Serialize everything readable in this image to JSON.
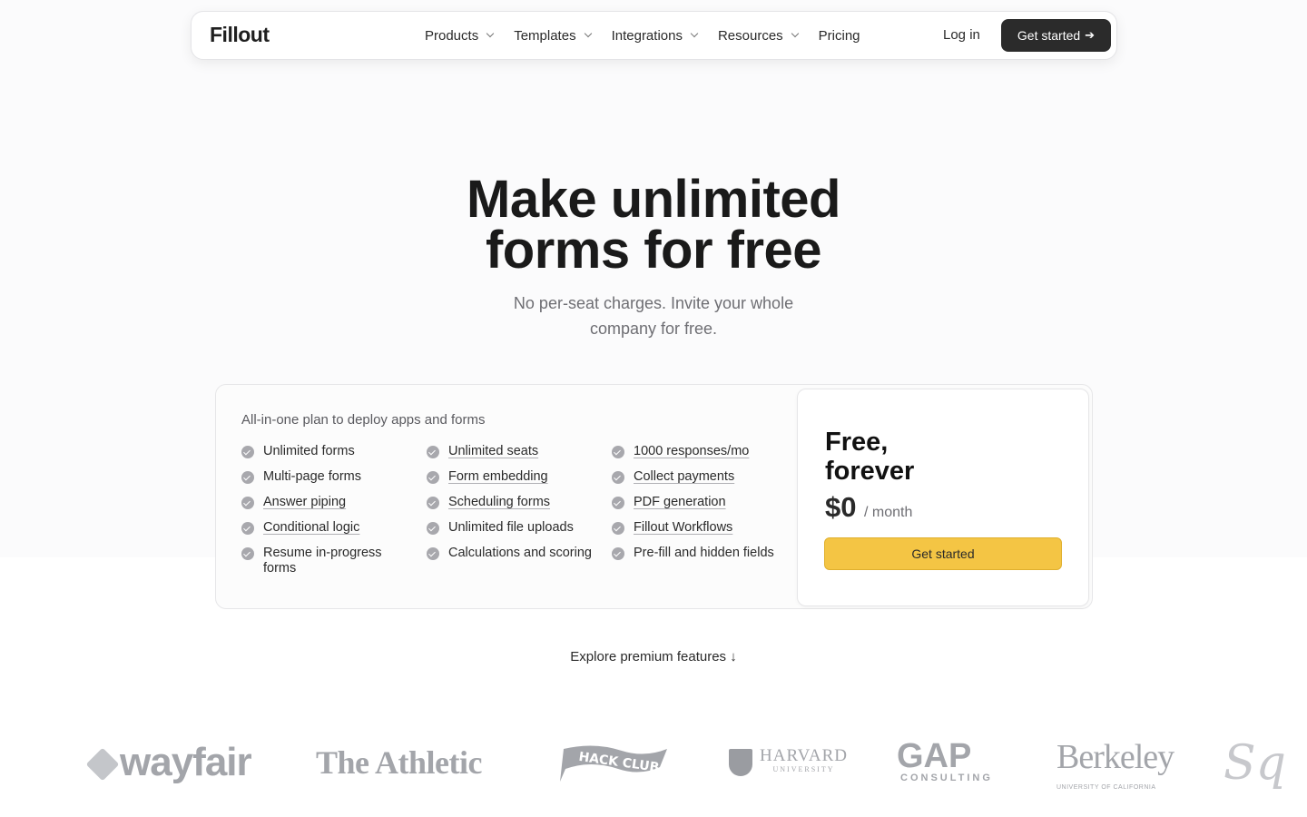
{
  "nav": {
    "logo": "Fillout",
    "items": [
      {
        "label": "Products",
        "has_dropdown": true
      },
      {
        "label": "Templates",
        "has_dropdown": true
      },
      {
        "label": "Integrations",
        "has_dropdown": true
      },
      {
        "label": "Resources",
        "has_dropdown": true
      },
      {
        "label": "Pricing",
        "has_dropdown": false
      }
    ],
    "login": "Log in",
    "cta": "Get started",
    "cta_arrow": "➔"
  },
  "hero": {
    "title_line1": "Make unlimited",
    "title_line2": "forms for free",
    "subtitle": "No per-seat charges. Invite your whole company for free."
  },
  "plan": {
    "heading": "All-in-one plan to deploy apps and forms",
    "features": [
      [
        {
          "label": "Unlimited forms",
          "underlined": false
        },
        {
          "label": "Multi-page forms",
          "underlined": false
        },
        {
          "label": "Answer piping",
          "underlined": true
        },
        {
          "label": "Conditional logic",
          "underlined": true
        },
        {
          "label": "Resume in-progress forms",
          "underlined": false
        }
      ],
      [
        {
          "label": "Unlimited seats",
          "underlined": true
        },
        {
          "label": "Form embedding",
          "underlined": true
        },
        {
          "label": "Scheduling forms",
          "underlined": true
        },
        {
          "label": "Unlimited file uploads",
          "underlined": false
        },
        {
          "label": "Calculations and scoring",
          "underlined": false
        }
      ],
      [
        {
          "label": "1000 responses/mo",
          "underlined": true
        },
        {
          "label": "Collect payments",
          "underlined": true
        },
        {
          "label": "PDF generation",
          "underlined": true
        },
        {
          "label": "Fillout Workflows",
          "underlined": true
        },
        {
          "label": "Pre-fill and hidden fields",
          "underlined": false
        }
      ]
    ],
    "price_card": {
      "title_line1": "Free,",
      "title_line2": "forever",
      "amount": "$0",
      "period": "/ month",
      "cta": "Get started"
    }
  },
  "explore": "Explore premium features ↓",
  "logos": {
    "wayfair": "wayfair",
    "athletic": "The Athletic",
    "hackclub": "HACK CLUB",
    "harvard": "HARVARD",
    "harvard_sub": "UNIVERSITY",
    "gap": "GAP",
    "gap_sub": "CONSULTING",
    "berkeley": "Berkeley",
    "berkeley_sub": "UNIVERSITY OF CALIFORNIA",
    "square": "Sq"
  },
  "colors": {
    "cta_dark": "#2b2b2b",
    "cta_yellow": "#f4c544",
    "logo_gray": "#a3a5aa"
  }
}
